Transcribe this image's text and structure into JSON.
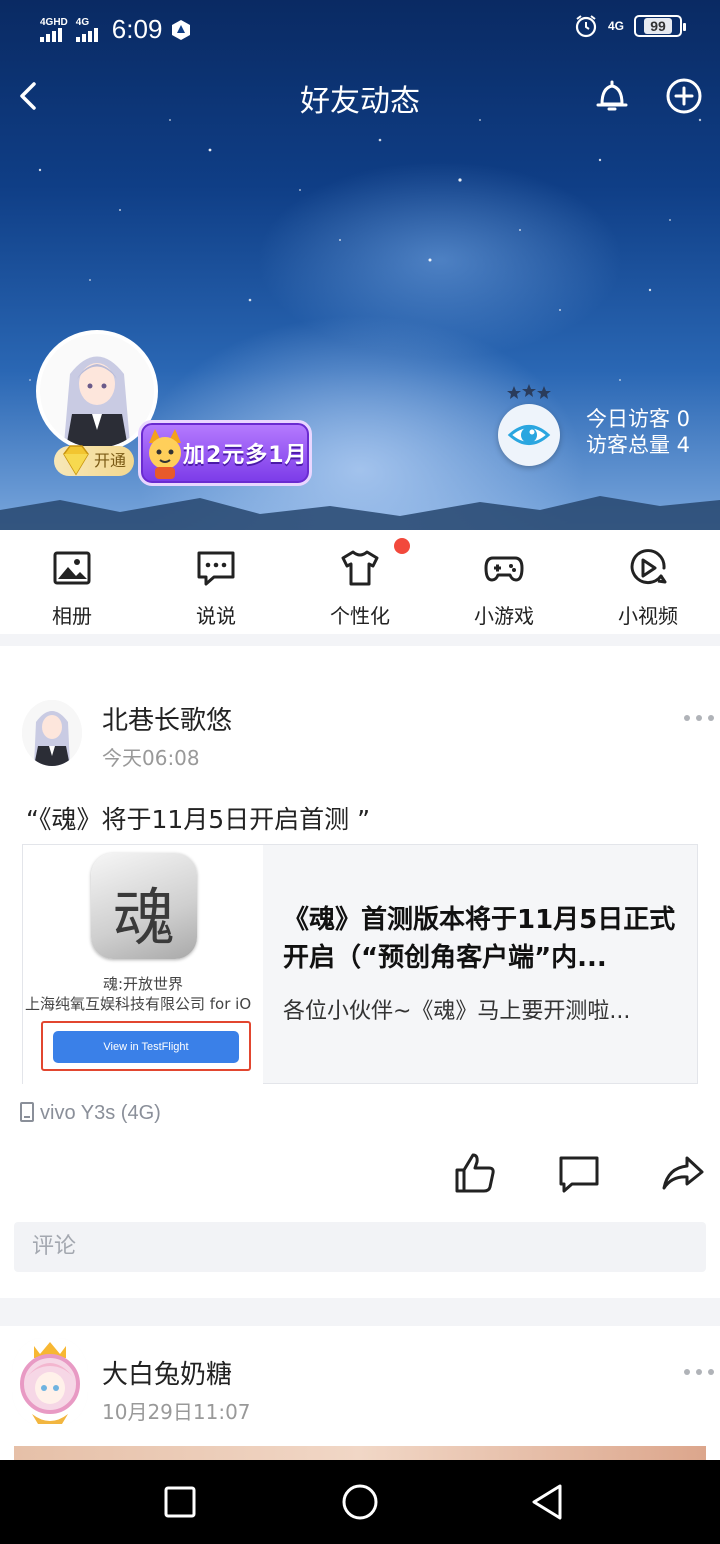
{
  "status_bar": {
    "network_1": "4GHD",
    "network_2": "4G",
    "time": "6:09",
    "network_right": "4G",
    "battery": "99"
  },
  "header": {
    "title": "好友动态"
  },
  "profile": {
    "vip_label": "开通",
    "promo_text": "加2元多1月",
    "today_visitors": "今日访客 0",
    "total_visitors": "访客总量 4"
  },
  "quick_nav": [
    {
      "label": "相册",
      "icon": "album-icon"
    },
    {
      "label": "说说",
      "icon": "talk-icon"
    },
    {
      "label": "个性化",
      "icon": "tshirt-icon"
    },
    {
      "label": "小游戏",
      "icon": "gamepad-icon"
    },
    {
      "label": "小视频",
      "icon": "video-icon"
    }
  ],
  "post1": {
    "author": "北巷长歌悠",
    "time": "今天06:08",
    "text": "“《魂》将于11月5日开启首测 ”",
    "card": {
      "app_glyph": "魂",
      "app_name": "魂:开放世界",
      "company": "上海纯氧互娱科技有限公司 for iO",
      "button": "View in TestFlight",
      "title": "《魂》首测版本将于11月5日正式开启（“预创角客户端”内...",
      "desc": "各位小伙伴~《魂》马上要开测啦..."
    },
    "device": "vivo Y3s (4G)",
    "comment_placeholder": "评论"
  },
  "post2": {
    "author": "大白兔奶糖",
    "time": "10月29日11:07"
  },
  "colors": {
    "accent_red": "#f2493c",
    "testflight_blue": "#3a80e8",
    "muted_text": "#999999"
  }
}
